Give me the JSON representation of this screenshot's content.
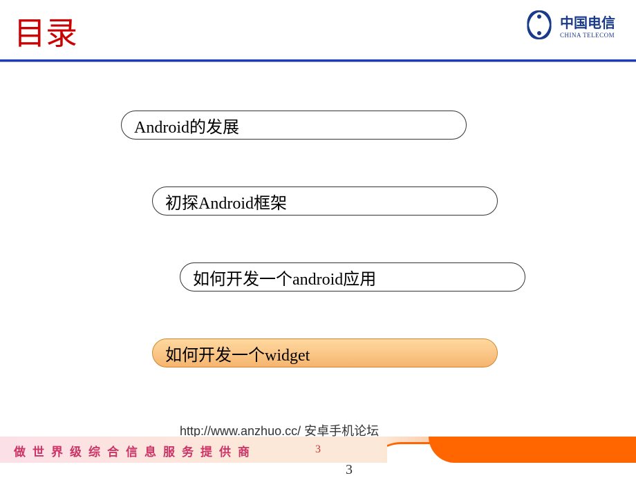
{
  "header": {
    "title": "目录",
    "brand_cn": "中国电信",
    "brand_en": "CHINA TELECOM"
  },
  "toc": {
    "items": [
      {
        "label": "Android的发展"
      },
      {
        "label": "初探Android框架"
      },
      {
        "label": "如何开发一个android应用"
      },
      {
        "label": "如何开发一个widget"
      }
    ]
  },
  "source": "http://www.anzhuo.cc/ 安卓手机论坛",
  "footer": {
    "slogan": "做世界级综合信息服务提供商",
    "page": "3",
    "page_alt": "3"
  }
}
